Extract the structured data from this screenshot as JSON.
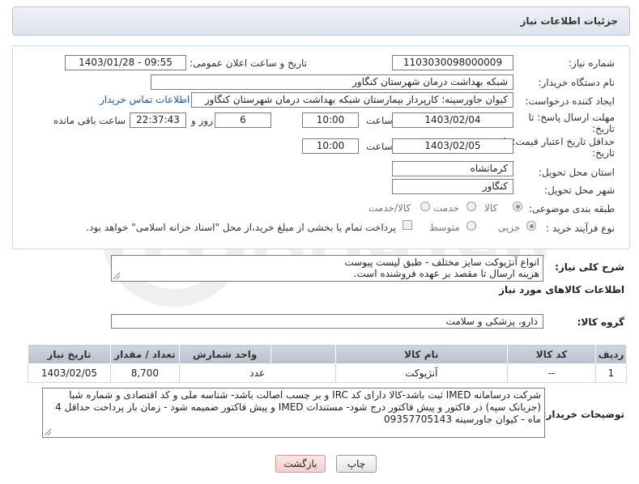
{
  "header": {
    "title": "جزئیات اطلاعات نیاز"
  },
  "fields": {
    "need_number": {
      "label": "شماره نیاز:",
      "value": "1103030098000009"
    },
    "announce_datetime": {
      "label": "تاریخ و ساعت اعلان عمومی:",
      "value": "1403/01/28 - 09:55"
    },
    "buyer_org": {
      "label": "نام دستگاه خریدار:",
      "value": "شبکه بهداشت درمان شهرستان کنگاور"
    },
    "requester": {
      "label": "ایجاد کننده درخواست:",
      "value": "کیوان جاورسینه؛ کارپرداز بیمارستان شبکه بهداشت درمان شهرستان کنگاور",
      "contact_link": "اطلاعات تماس خریدار"
    },
    "reply_deadline": {
      "label_line1": "مهلت ارسال پاسخ: تا",
      "label_line2": "تاریخ:",
      "date": "1403/02/04",
      "time_label": "ساعت",
      "time": "10:00",
      "days": "6",
      "days_label": "روز و",
      "remaining_time": "22:37:43",
      "remaining_label": "ساعت باقی مانده"
    },
    "price_validity": {
      "label_line1": "حداقل تاریخ اعتبار قیمت: تا",
      "label_line2": "تاریخ:",
      "date": "1403/02/05",
      "time_label": "ساعت",
      "time": "10:00"
    },
    "province": {
      "label": "استان محل تحویل:",
      "value": "کرمانشاه"
    },
    "city": {
      "label": "شهر محل تحویل:",
      "value": "کنگاور"
    },
    "category": {
      "label": "طبقه بندی موضوعی:",
      "options": [
        "کالا",
        "خدمت",
        "کالا/خدمت"
      ],
      "selected": "کالا"
    },
    "purchase_process": {
      "label": "نوع فرآیند خرید :",
      "options": [
        "جزیی",
        "متوسط"
      ],
      "selected": "جزیی",
      "payment_note": "پرداخت تمام یا بخشی از مبلغ خرید،از محل \"اسناد خزانه اسلامی\" خواهد بود."
    }
  },
  "description": {
    "label": "شرح کلی نیاز:",
    "line1": "انواع آنژیوکت سایز مختلف - طبق لیست پیوست",
    "line2": "هزینه ارسال تا مقصد بر عهده فروشنده است."
  },
  "goods_section": {
    "title": "اطلاعات کالاهای مورد نیاز",
    "group_label": "گروه کالا:",
    "group_value": "دارو، پزشکی و سلامت"
  },
  "table": {
    "headers": [
      "ردیف",
      "کد کالا",
      "نام کالا",
      "واحد شمارش",
      "تعداد / مقدار",
      "تاریخ نیاز"
    ],
    "rows": [
      [
        "1",
        "--",
        "آنژیوکت",
        "عدد",
        "8,700",
        "1403/02/05"
      ]
    ]
  },
  "buyer_notes": {
    "label": "توضیحات خریدار:",
    "text": "شرکت درسامانه IMED ثبت باشد-کالا دارای کد IRC و بر چسب اصالت باشد- شناسه ملی و کد اقتصادی و شماره شبا (جزبانک سپه) در فاکتور و پیش فاکتور درج شود- مستندات IMED و پیش فاکتور ضمیمه شود - زمان باز پرداخت حداقل 4 ماه - کیوان جاورسینه 09357705143"
  },
  "buttons": {
    "print": "چاپ",
    "back": "بازگشت"
  },
  "watermark": {
    "text": "AriaTender.net"
  }
}
